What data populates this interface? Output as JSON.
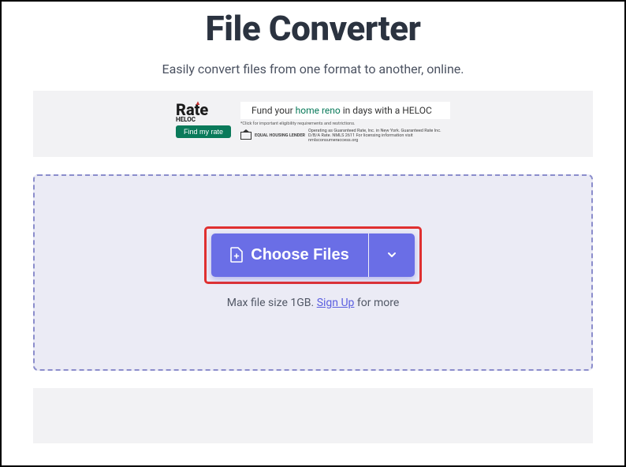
{
  "header": {
    "title": "File Converter",
    "subtitle": "Easily convert files from one format to another, online."
  },
  "ad": {
    "logo_text": "Rate",
    "logo_sub": "HELOC",
    "cta_button": "Find my rate",
    "headline_prefix": "Fund your ",
    "headline_highlight": "home reno",
    "headline_suffix": " in days with a HELOC",
    "disclaimer_line1": "*Click for important eligibility requirements and restrictions.",
    "lender_label": "EQUAL HOUSING LENDER",
    "lender_text": "Operating as Guaranteed Rate, Inc. in New York. Guaranteed Rate Inc. D/B/A Rate. NMLS 2611 For licensing information visit nmlsconsumeraccess.org"
  },
  "dropzone": {
    "choose_button": "Choose Files",
    "max_prefix": "Max file size 1GB. ",
    "signup_link": "Sign Up",
    "max_suffix": " for more"
  }
}
